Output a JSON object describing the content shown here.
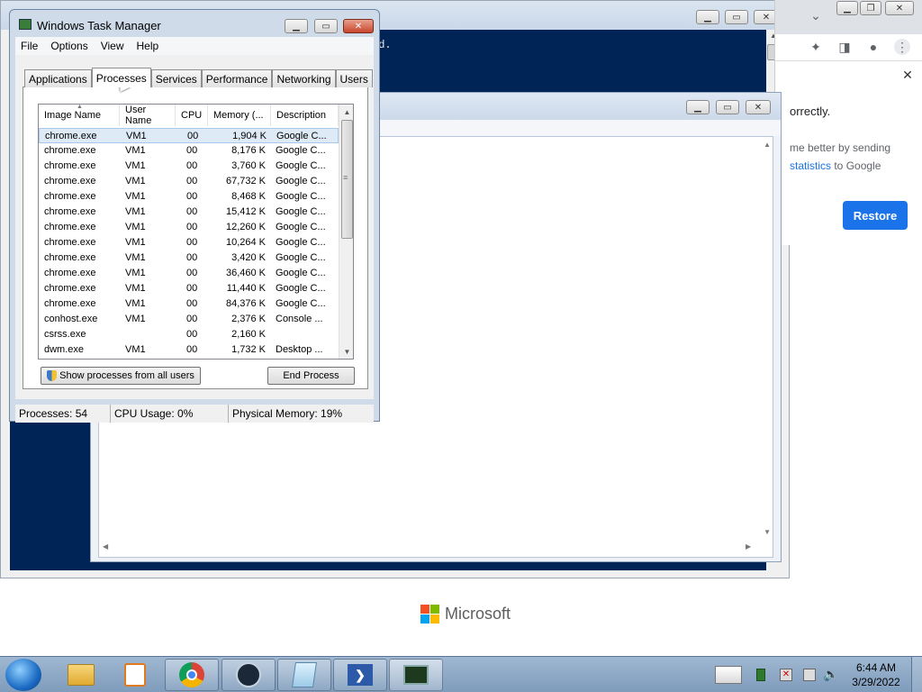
{
  "console_text": "ed.",
  "chrome": {
    "partial_line1": "orrectly.",
    "partial_line2": "me better by sending",
    "link_statistics": "statistics",
    "to_google": " to Google",
    "restore_label": "Restore"
  },
  "task_manager": {
    "title": "Windows Task Manager",
    "menu": [
      "File",
      "Options",
      "View",
      "Help"
    ],
    "tabs": [
      "Applications",
      "Processes",
      "Services",
      "Performance",
      "Networking",
      "Users"
    ],
    "active_tab": "Processes",
    "columns": [
      "Image Name",
      "User Name",
      "CPU",
      "Memory (...",
      "Description"
    ],
    "processes": [
      [
        "chrome.exe",
        "VM1",
        "00",
        "1,904 K",
        "Google C..."
      ],
      [
        "chrome.exe",
        "VM1",
        "00",
        "8,176 K",
        "Google C..."
      ],
      [
        "chrome.exe",
        "VM1",
        "00",
        "3,760 K",
        "Google C..."
      ],
      [
        "chrome.exe",
        "VM1",
        "00",
        "67,732 K",
        "Google C..."
      ],
      [
        "chrome.exe",
        "VM1",
        "00",
        "8,468 K",
        "Google C..."
      ],
      [
        "chrome.exe",
        "VM1",
        "00",
        "15,412 K",
        "Google C..."
      ],
      [
        "chrome.exe",
        "VM1",
        "00",
        "12,260 K",
        "Google C..."
      ],
      [
        "chrome.exe",
        "VM1",
        "00",
        "10,264 K",
        "Google C..."
      ],
      [
        "chrome.exe",
        "VM1",
        "00",
        "3,420 K",
        "Google C..."
      ],
      [
        "chrome.exe",
        "VM1",
        "00",
        "36,460 K",
        "Google C..."
      ],
      [
        "chrome.exe",
        "VM1",
        "00",
        "11,440 K",
        "Google C..."
      ],
      [
        "chrome.exe",
        "VM1",
        "00",
        "84,376 K",
        "Google C..."
      ],
      [
        "conhost.exe",
        "VM1",
        "00",
        "2,376 K",
        "Console ..."
      ],
      [
        "csrss.exe",
        "",
        "00",
        "2,160 K",
        ""
      ],
      [
        "dwm.exe",
        "VM1",
        "00",
        "1,732 K",
        "Desktop ..."
      ]
    ],
    "show_all_label": "Show processes from all users",
    "end_process_label": "End Process",
    "status": {
      "processes": "Processes: 54",
      "cpu": "CPU Usage: 0%",
      "memory": "Physical Memory: 19%"
    }
  },
  "microsoft_logo_text": "Microsoft",
  "taskbar": {
    "time": "6:44 AM",
    "date": "3/29/2022"
  },
  "colors": {
    "console_bg": "#012456",
    "chrome_button": "#1a73e8",
    "ms_red": "#f25022",
    "ms_green": "#7fba00",
    "ms_blue": "#00a4ef",
    "ms_yellow": "#ffb900"
  }
}
